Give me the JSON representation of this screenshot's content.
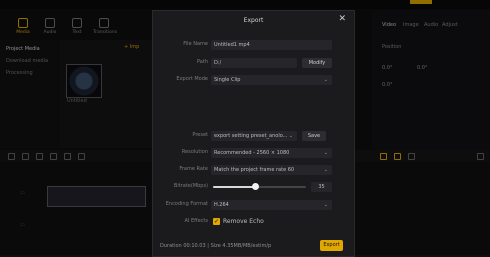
{
  "tools": [
    {
      "label": "Media",
      "icon": "media-icon",
      "active": true
    },
    {
      "label": "Audio",
      "icon": "audio-icon",
      "active": false
    },
    {
      "label": "Text",
      "icon": "text-icon",
      "active": false
    },
    {
      "label": "Transitions",
      "icon": "transitions-icon",
      "active": false
    }
  ],
  "leftnav": {
    "items": [
      "Project Media",
      "Download media",
      "Processing"
    ]
  },
  "media": {
    "import_label": "+ Imp",
    "thumb_label": "Untitled"
  },
  "right_panel": {
    "tabs": [
      "Video",
      "Image",
      "Audio",
      "Adjust"
    ],
    "title": "Position",
    "values": {
      "x": "0.0°",
      "y": "0.0°",
      "r": "0.0°"
    }
  },
  "modal": {
    "title": "Export",
    "close": "✕",
    "rows": {
      "file_name": {
        "label": "File Name",
        "value": "Untitled1 mp4"
      },
      "path": {
        "label": "Path",
        "value": "D:/"
      },
      "export_mode": {
        "label": "Export Mode",
        "value": "Single Clip"
      },
      "preset": {
        "label": "Preset",
        "value": "export setting preset_anolo..."
      },
      "resolution": {
        "label": "Resolution",
        "value": "Recommended - 2560 × 1080"
      },
      "frame_rate": {
        "label": "Frame Rate",
        "value": "Match the project frame rate 60"
      },
      "bitrate": {
        "label": "Bitrate(Mbps)",
        "value": "35",
        "level": 0.45
      },
      "encoding": {
        "label": "Encoding Format",
        "value": "H.264"
      },
      "ai_effects": {
        "label": "AI Effects",
        "value": "Remove Echo",
        "checked": true
      }
    },
    "modify_label": "Modify",
    "save_label": "Save",
    "footer": {
      "duration_label": "Duration",
      "duration": "00:10.03",
      "size_label": "Size",
      "size": "4.35MB/MB/estim/p"
    },
    "export_label": "Export"
  }
}
